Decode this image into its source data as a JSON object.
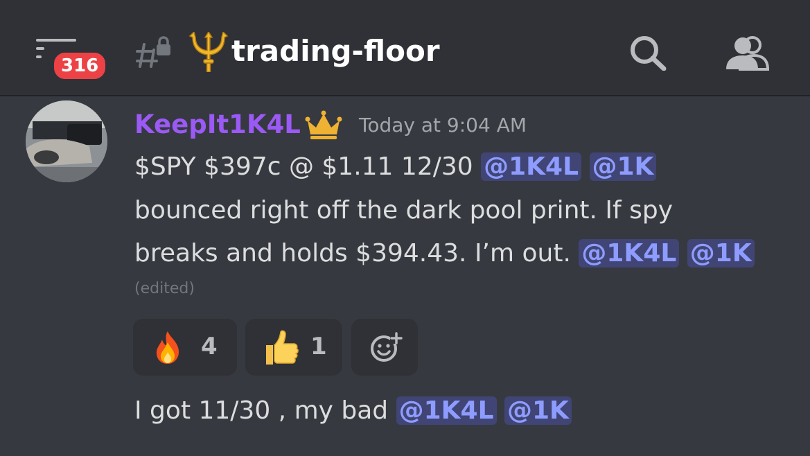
{
  "header": {
    "unread_badge": "316",
    "channel_name": "trading-floor",
    "menu_icon": "hamburger-menu-icon",
    "channel_icon": "locked-hash-icon",
    "channel_emoji": "trident-emoji",
    "search_icon": "search-icon",
    "members_icon": "members-icon"
  },
  "message": {
    "author": "KeepIt1K4L",
    "author_color": "#9b59f5",
    "author_badge": "crown-icon",
    "timestamp": "Today at 9:04 AM",
    "line1_text": "$SPY $397c @ $1.11 12/30",
    "line1_mention1": "@1K4L",
    "line1_mention2": "@1K",
    "line2_text": "bounced right off the dark pool print. If spy",
    "line3_text": "breaks and holds $394.43. I’m out.",
    "line3_mention1": "@1K4L",
    "line3_mention2": "@1K",
    "edited_label": "(edited)",
    "reactions": [
      {
        "emoji": "fire-emoji",
        "count": "4"
      },
      {
        "emoji": "thumbs-up-emoji",
        "count": "1"
      },
      {
        "emoji": "add-reaction-icon",
        "count": ""
      }
    ]
  },
  "followup": {
    "text": "I got 11/30 , my bad",
    "mention1": "@1K4L",
    "mention2": "@1K"
  },
  "colors": {
    "background": "#36393f",
    "header": "#2f3136",
    "mention_text": "#8e9cff",
    "badge": "#ed4245"
  }
}
